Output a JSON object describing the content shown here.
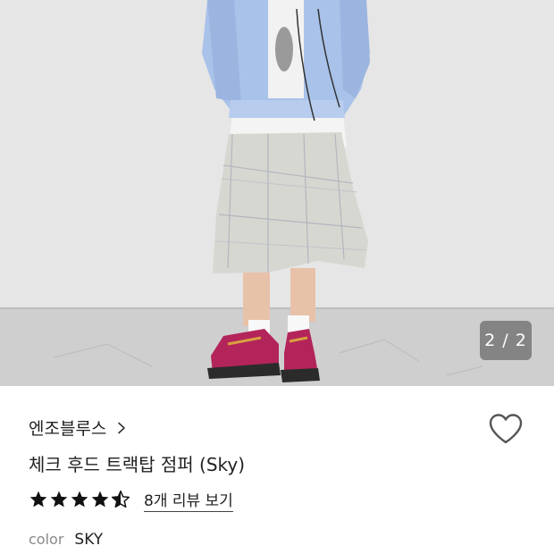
{
  "image": {
    "alt": "",
    "page_indicator": "2 / 2",
    "current_page": 2,
    "total_pages": 2
  },
  "product": {
    "brand": "엔조블루스",
    "title": "체크 후드 트랙탑 점퍼 (Sky)",
    "rating": 4.5,
    "review_link": "8개 리뷰 보기",
    "color_label": "color",
    "color_value": "SKY"
  },
  "icons": {
    "brand_chevron": "chevron-right-icon",
    "wishlist": "heart-outline-icon",
    "rating": "star-icon"
  },
  "colors": {
    "text_primary": "#222222",
    "text_muted": "#8a8a8a",
    "indicator_bg": "#6e6e6e"
  }
}
